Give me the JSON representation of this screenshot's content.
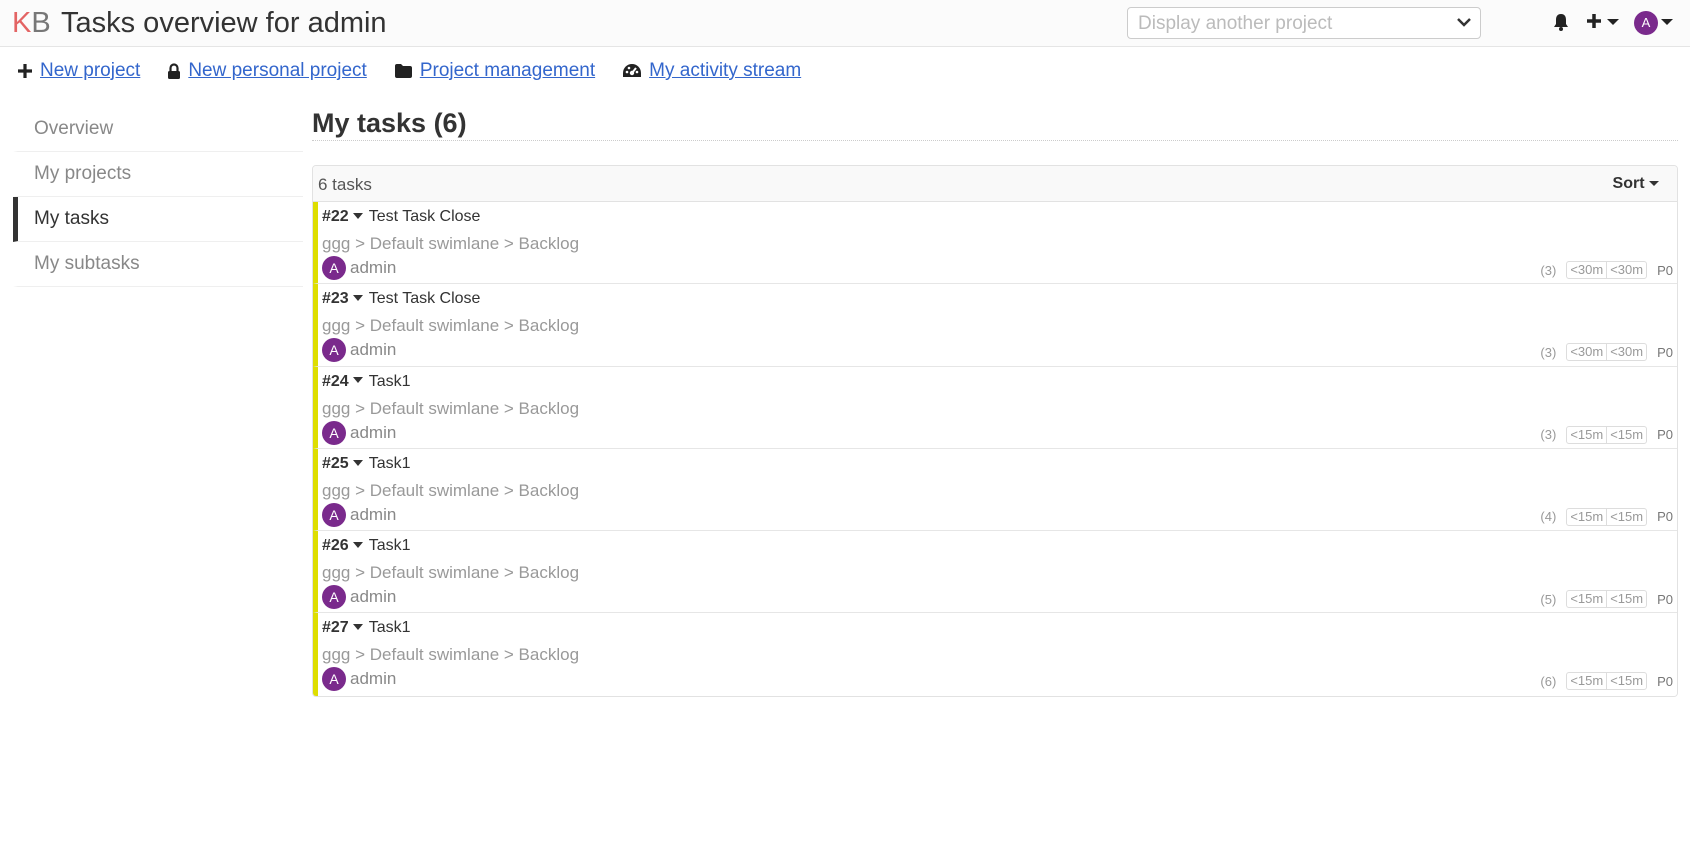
{
  "header": {
    "logo_k": "K",
    "logo_b": "B",
    "title": "Tasks overview for admin",
    "project_select_placeholder": "Display another project",
    "user_initial": "A"
  },
  "actions": [
    {
      "label": "New project",
      "icon": "plus-icon"
    },
    {
      "label": "New personal project",
      "icon": "lock-icon"
    },
    {
      "label": "Project management",
      "icon": "folder-icon"
    },
    {
      "label": "My activity stream",
      "icon": "dashboard-icon"
    }
  ],
  "sidebar": {
    "items": [
      {
        "label": "Overview",
        "active": false
      },
      {
        "label": "My projects",
        "active": false
      },
      {
        "label": "My tasks",
        "active": true
      },
      {
        "label": "My subtasks",
        "active": false
      }
    ]
  },
  "main": {
    "title": "My tasks (6)",
    "count_label": "6 tasks",
    "sort_label": "Sort",
    "accent_color": "#dede00",
    "tasks": [
      {
        "id": "#22",
        "title": "Test Task Close",
        "path": "ggg > Default swimlane > Backlog",
        "assignee_initial": "A",
        "assignee": "admin",
        "position": "(3)",
        "time_spent": "<30m",
        "time_estimated": "<30m",
        "priority": "P0"
      },
      {
        "id": "#23",
        "title": "Test Task Close",
        "path": "ggg > Default swimlane > Backlog",
        "assignee_initial": "A",
        "assignee": "admin",
        "position": "(3)",
        "time_spent": "<30m",
        "time_estimated": "<30m",
        "priority": "P0"
      },
      {
        "id": "#24",
        "title": "Task1",
        "path": "ggg > Default swimlane > Backlog",
        "assignee_initial": "A",
        "assignee": "admin",
        "position": "(3)",
        "time_spent": "<15m",
        "time_estimated": "<15m",
        "priority": "P0"
      },
      {
        "id": "#25",
        "title": "Task1",
        "path": "ggg > Default swimlane > Backlog",
        "assignee_initial": "A",
        "assignee": "admin",
        "position": "(4)",
        "time_spent": "<15m",
        "time_estimated": "<15m",
        "priority": "P0"
      },
      {
        "id": "#26",
        "title": "Task1",
        "path": "ggg > Default swimlane > Backlog",
        "assignee_initial": "A",
        "assignee": "admin",
        "position": "(5)",
        "time_spent": "<15m",
        "time_estimated": "<15m",
        "priority": "P0"
      },
      {
        "id": "#27",
        "title": "Task1",
        "path": "ggg > Default swimlane > Backlog",
        "assignee_initial": "A",
        "assignee": "admin",
        "position": "(6)",
        "time_spent": "<15m",
        "time_estimated": "<15m",
        "priority": "P0"
      }
    ]
  }
}
